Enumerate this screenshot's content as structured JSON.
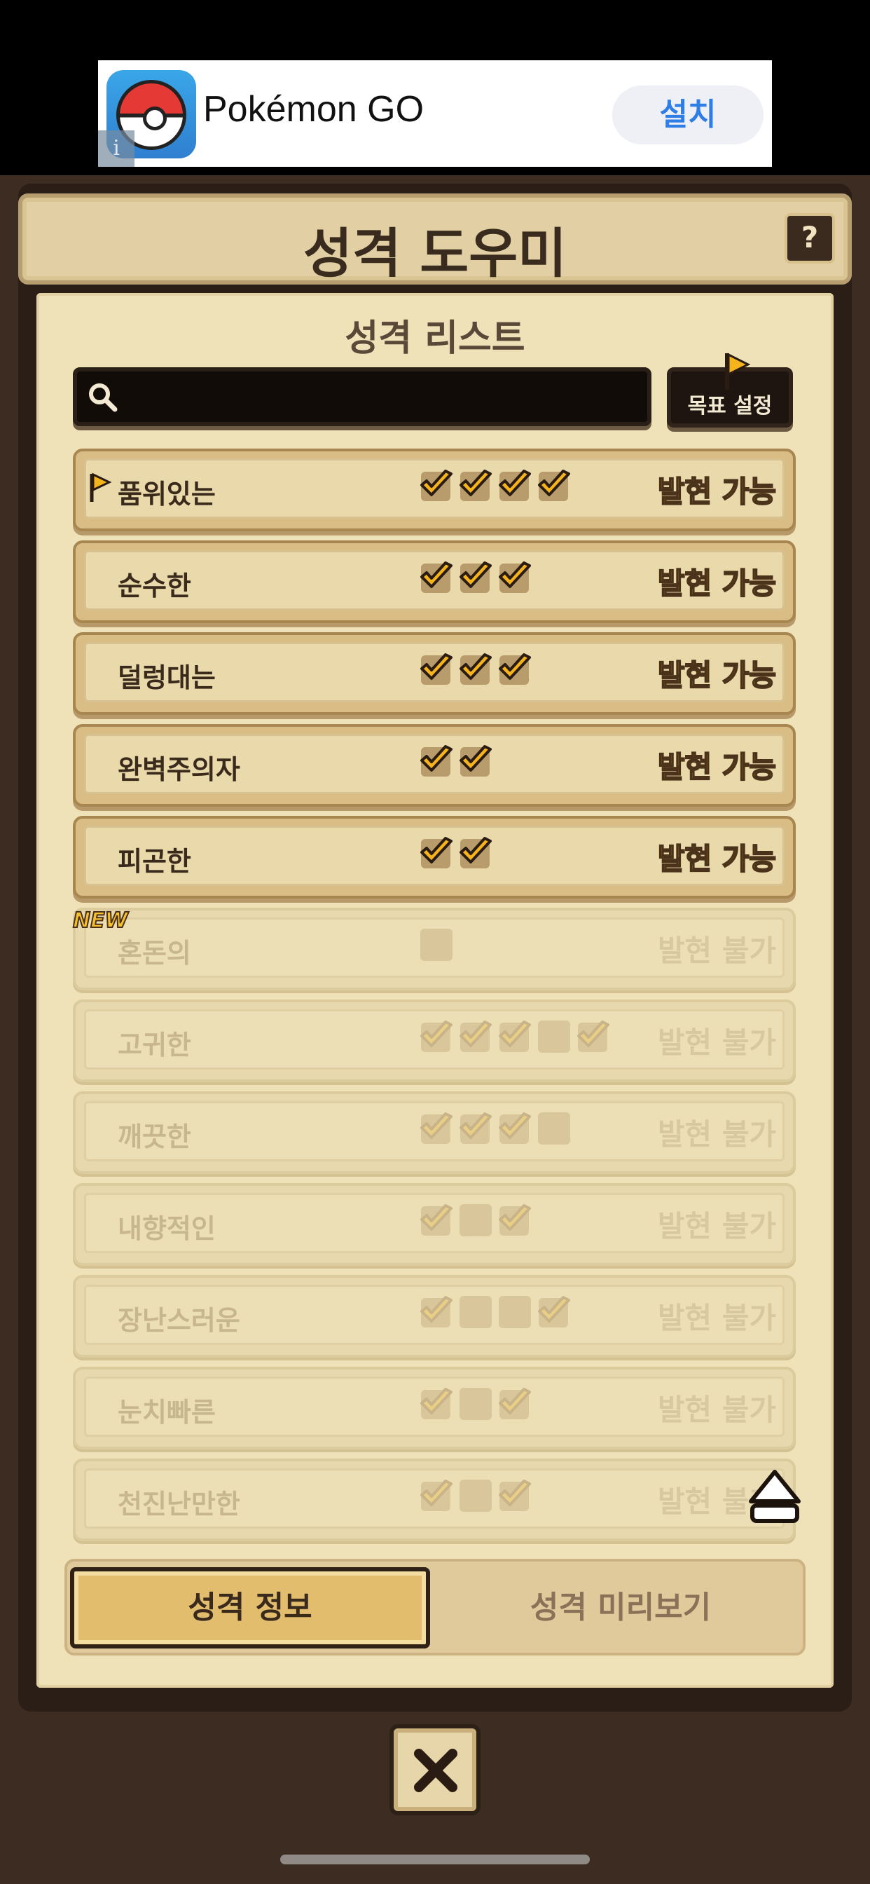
{
  "ad": {
    "app_name": "Pokémon GO",
    "install_label": "설치",
    "info_icon": "info-icon"
  },
  "header": {
    "title": "성격 도우미",
    "help_label": "?"
  },
  "list": {
    "title": "성격 리스트",
    "search_placeholder": "",
    "goal_button": "목표 설정",
    "new_badge": "NEW",
    "rows": [
      {
        "name": "품위있는",
        "status": "발현 가능",
        "active": true,
        "flag": true,
        "checks": [
          "c",
          "c",
          "c",
          "c"
        ]
      },
      {
        "name": "순수한",
        "status": "발현 가능",
        "active": true,
        "flag": false,
        "checks": [
          "c",
          "c",
          "c"
        ]
      },
      {
        "name": "덜렁대는",
        "status": "발현 가능",
        "active": true,
        "flag": false,
        "checks": [
          "c",
          "c",
          "c"
        ]
      },
      {
        "name": "완벽주의자",
        "status": "발현 가능",
        "active": true,
        "flag": false,
        "checks": [
          "c",
          "c"
        ]
      },
      {
        "name": "피곤한",
        "status": "발현 가능",
        "active": true,
        "flag": false,
        "checks": [
          "c",
          "c"
        ]
      },
      {
        "name": "혼돈의",
        "status": "발현 불가",
        "active": false,
        "flag": false,
        "checks": [
          "s"
        ]
      },
      {
        "name": "고귀한",
        "status": "발현 불가",
        "active": false,
        "flag": false,
        "checks": [
          "c",
          "c",
          "c",
          "s",
          "c"
        ]
      },
      {
        "name": "깨끗한",
        "status": "발현 불가",
        "active": false,
        "flag": false,
        "checks": [
          "c",
          "c",
          "c",
          "s"
        ]
      },
      {
        "name": "내향적인",
        "status": "발현 불가",
        "active": false,
        "flag": false,
        "checks": [
          "c",
          "s",
          "c"
        ]
      },
      {
        "name": "장난스러운",
        "status": "발현 불가",
        "active": false,
        "flag": false,
        "checks": [
          "c",
          "s",
          "s",
          "c"
        ]
      },
      {
        "name": "눈치빠른",
        "status": "발현 불가",
        "active": false,
        "flag": false,
        "checks": [
          "c",
          "s",
          "c"
        ]
      },
      {
        "name": "천진난만한",
        "status": "발현 불가",
        "active": false,
        "flag": false,
        "checks": [
          "c",
          "s",
          "c"
        ]
      }
    ]
  },
  "tabs": {
    "info": "성격 정보",
    "preview": "성격 미리보기"
  },
  "colors": {
    "accent_gold": "#f5b31c",
    "dark_brown": "#3a2a1c",
    "paper": "#efe2b8"
  }
}
